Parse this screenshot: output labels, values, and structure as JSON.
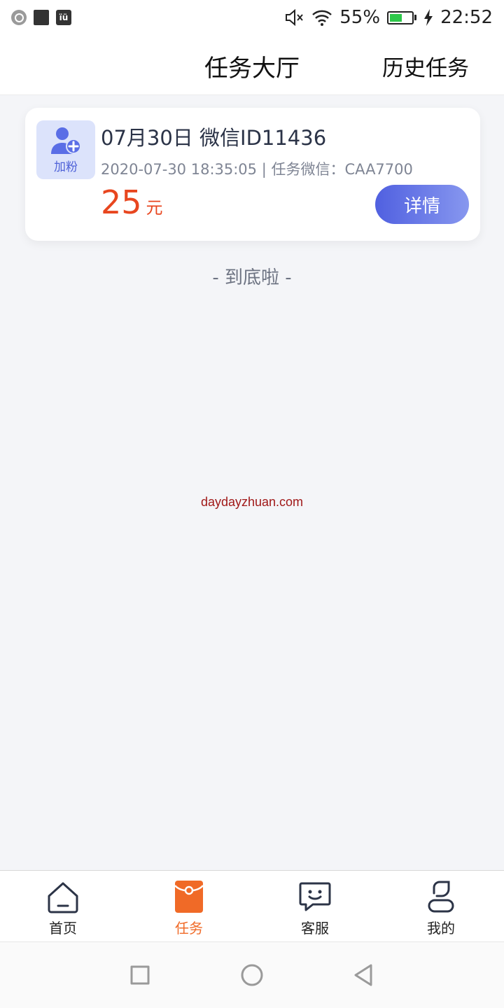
{
  "status_bar": {
    "battery_percent": "55%",
    "battery_level": 0.55,
    "time": "22:52",
    "icons": [
      "search-notification-icon",
      "app-notification-icon",
      "app-notification-icon",
      "mute-icon",
      "wifi-icon",
      "battery-icon",
      "charging-icon"
    ]
  },
  "header": {
    "title": "任务大厅",
    "history_link": "历史任务"
  },
  "task_card": {
    "icon_label": "加粉",
    "title": "07月30日 微信ID11436",
    "meta": "2020-07-30 18:35:05 | 任务微信：CAA7700",
    "reward_amount": "25",
    "reward_unit": "元",
    "detail_button": "详情",
    "accent_color": "#5060e0",
    "reward_color": "#e8461f"
  },
  "list_end_text": "- 到底啦 -",
  "watermark": "daydayzhuan.com",
  "tab_bar": {
    "active_color": "#f06a27",
    "items": [
      {
        "label": "首页",
        "icon": "home-icon",
        "active": false
      },
      {
        "label": "任务",
        "icon": "red-envelope-icon",
        "active": true
      },
      {
        "label": "客服",
        "icon": "chat-icon",
        "active": false
      },
      {
        "label": "我的",
        "icon": "profile-icon",
        "active": false
      }
    ]
  },
  "nav_bar": {
    "icons": [
      "recents-icon",
      "home-circle-icon",
      "back-icon"
    ]
  }
}
